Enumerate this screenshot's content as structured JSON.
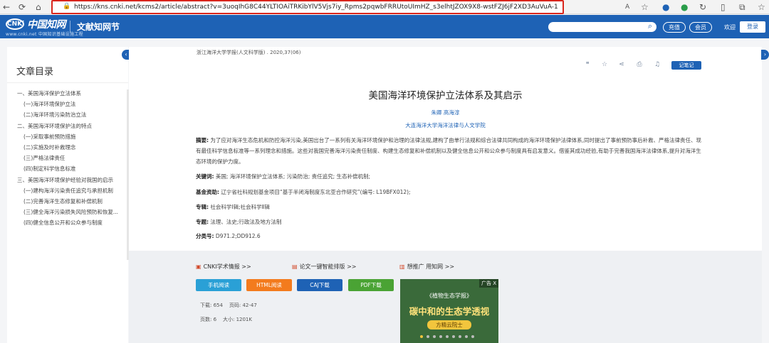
{
  "browser": {
    "back_icon": "back-arrow-icon",
    "refresh_icon": "refresh-icon",
    "home_icon": "home-icon",
    "lock_icon": "lock-icon",
    "url": "https://kns.cnki.net/kcms2/article/abstract?v=3uoqIhG8C44YLTIOAiTRKibYlV5Vjs7iy_Rpms2pqwbFRRUtoUImHZ_s3elhtJZOX9X8-wstFZJ6jF2XD3AuVuA-11dpxGPI&uniplatform=NZKPT"
  },
  "header": {
    "logo_mark": "CNKi",
    "logo_text": "中国知网",
    "logo_sub": "www.cnki.net  中国知识基础设施工程",
    "section_title": "文献知网节",
    "search_placeholder": "",
    "buttons": {
      "recharge": "充值",
      "member": "会员"
    },
    "welcome": "欢迎",
    "login": "登录"
  },
  "toc": {
    "title": "文章目录",
    "items": [
      {
        "text": "一、美国海洋保护立法体系",
        "level": 1
      },
      {
        "text": "(一)海洋环境保护立法",
        "level": 2
      },
      {
        "text": "(二)海洋环境污染防治立法",
        "level": 2
      },
      {
        "text": "二、美国海洋环境保护法的特点",
        "level": 1
      },
      {
        "text": "(一)采取事前预防措施",
        "level": 2
      },
      {
        "text": "(二)实施及时补救理念",
        "level": 2
      },
      {
        "text": "(三)严格法律责任",
        "level": 2
      },
      {
        "text": "(四)制定科学信息标准",
        "level": 2
      },
      {
        "text": "三、美国海洋环境保护经验对我国的启示",
        "level": 1
      },
      {
        "text": "(一)建构海洋污染责任追究与承担机制",
        "level": 2
      },
      {
        "text": "(二)完善海洋生态修复和补偿机制",
        "level": 2
      },
      {
        "text": "(三)健全海洋污染损失风险预防和恢复...",
        "level": 2
      },
      {
        "text": "(四)健全信息公开和公众参与制度",
        "level": 2
      }
    ]
  },
  "article": {
    "source": "浙江海洋大学学报(人文科学版) . 2020,37(06)",
    "note_button": "记笔记",
    "title": "美国海洋环境保护立法体系及其启示",
    "authors": "朱卿    高海淳",
    "affiliation": "大连海洋大学海洋法律与人文学院",
    "abstract_label": "摘要:",
    "abstract": "为了应对海洋生态危机和防控海洋污染,美国出台了一系列有关海洋环境保护和治理的法律法规,建构了由单行法规和综合法律共同构成的海洋环境保护法律体系,同时提出了事前预防事后补救、严格法律责任、现有最佳科学信息标准等一系列理念和措施。这些对我国完善海洋污染责任制度、构建生态修复和补偿机制以及健全信息公开和公众参与制度具有启发意义。借鉴其成功经验,有助于完善我国海洋法律体系,提升对海洋生态环境的保护力度。",
    "keywords_label": "关键词:",
    "keywords": "美国;  海洋环境保护立法体系;  污染防治;  责任追究;  生态补偿机制;",
    "fund_label": "基金资助:",
    "fund": "辽宁省社科规划基金项目“基于半闭海制度东北亚合作研究”(编号: L19BFX012);",
    "column_label": "专辑:",
    "column": "社会科学Ⅰ辑;社会科学Ⅱ辑",
    "topic_label": "专题:",
    "topic": "法理、法史;行政法及地方法制",
    "class_label": "分类号:",
    "class": "D971.2;DD912.6"
  },
  "downloads": {
    "links": [
      "CNKI学术情报 >>",
      "论文一键智能排版 >>",
      "想推广 用知网 >>"
    ],
    "buttons": {
      "mobile": "手机阅读",
      "html": "HTML阅读",
      "caj": "CAJ下载",
      "pdf": "PDF下载"
    },
    "stats": {
      "downloads_label": "下载:",
      "downloads": "654",
      "pages_label": "页码:",
      "pages": "42-47",
      "page_count_label": "页数:",
      "page_count": "6",
      "size_label": "大小:",
      "size": "1201K"
    }
  },
  "ad": {
    "tag": "广告 X",
    "line1": "《植物生态学报》",
    "headline": "碳中和的生态学透视",
    "sub": "方精云院士"
  },
  "colors": {
    "brand": "#1e62b5",
    "url_highlight": "#d9251c",
    "html_button": "#f37b1d",
    "pdf_button": "#4aa334"
  }
}
